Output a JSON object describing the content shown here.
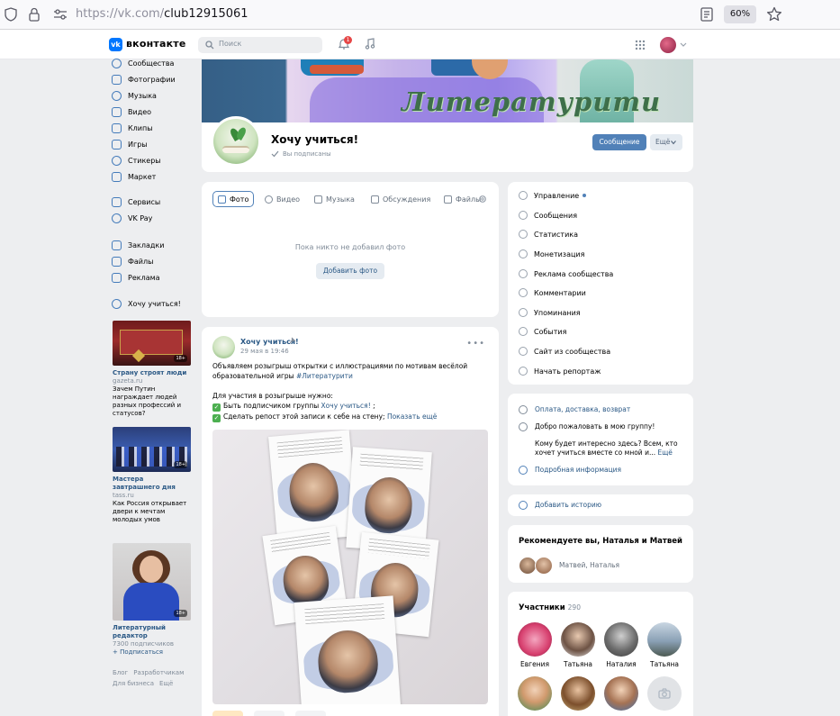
{
  "browser": {
    "url_host": "https://vk.com/",
    "url_path": "club12915061",
    "zoom": "60%"
  },
  "header": {
    "brand": "вконтакте",
    "logo_text": "vk",
    "search_placeholder": "Поиск",
    "notifications_count": "1"
  },
  "left_nav": {
    "items": [
      {
        "label": "Сообщества",
        "icon": "community-icon"
      },
      {
        "label": "Фотографии",
        "icon": "photos-icon"
      },
      {
        "label": "Музыка",
        "icon": "music-icon"
      },
      {
        "label": "Видео",
        "icon": "video-icon"
      },
      {
        "label": "Клипы",
        "icon": "clips-icon"
      },
      {
        "label": "Игры",
        "icon": "games-icon"
      },
      {
        "label": "Стикеры",
        "icon": "stickers-icon"
      },
      {
        "label": "Маркет",
        "icon": "market-icon"
      },
      {
        "label": "Сервисы",
        "icon": "services-icon"
      },
      {
        "label": "VK Pay",
        "icon": "vkpay-icon"
      },
      {
        "label": "Закладки",
        "icon": "bookmarks-icon"
      },
      {
        "label": "Файлы",
        "icon": "files-icon"
      },
      {
        "label": "Реклама",
        "icon": "ads-icon"
      },
      {
        "label": "Хочу учиться!",
        "icon": "group-icon"
      }
    ]
  },
  "ads": [
    {
      "title": "Страну строят люди",
      "domain": "gazeta.ru",
      "text": "Зачем Путин награждает людей разных профессий и статусов?",
      "age": "18+"
    },
    {
      "title": "Мастера завтрашнего дня",
      "domain": "tass.ru",
      "text": "Как Россия открывает двери к мечтам молодых умов",
      "age": "18+"
    },
    {
      "title": "Литературный редактор",
      "domain": "7300 подписчиков",
      "text": "+ Подписаться",
      "age": "18+"
    }
  ],
  "footer": {
    "links": [
      "Блог",
      "Разработчикам",
      "Для бизнеса",
      "Ещё"
    ]
  },
  "cover": {
    "title_art": "Литературити"
  },
  "group": {
    "name": "Хочу учиться!",
    "status": "Вы подписаны",
    "message_button": "Сообщение",
    "more_button": "Ещё"
  },
  "media": {
    "tabs": [
      "Фото",
      "Видео",
      "Музыка",
      "Обсуждения",
      "Файлы"
    ],
    "empty_text": "Пока никто не добавил фото",
    "add_photo_button": "Добавить фото"
  },
  "post": {
    "author": "Хочу учиться!",
    "date": "29 мая в 19:46",
    "line1": "Объявляем розыгрыш открытки с иллюстрациями по мотивам весёлой",
    "line2": "образовательной игры ",
    "hashtag": "#Литературити",
    "line3": "Для участия в розыгрыше нужно:",
    "req1_prefix": "Быть подписчиком группы ",
    "req1_link": "Хочу учиться!",
    "req1_suffix": " ;",
    "req2_prefix": "Сделать репост этой записи к себе на стену; ",
    "show_more": "Показать ещё"
  },
  "manage_menu": {
    "items": [
      {
        "label": "Управление",
        "icon": "settings-icon"
      },
      {
        "label": "Сообщения",
        "icon": "messages-icon"
      },
      {
        "label": "Статистика",
        "icon": "stats-icon"
      },
      {
        "label": "Монетизация",
        "icon": "money-icon"
      },
      {
        "label": "Реклама сообщества",
        "icon": "megaphone-icon"
      },
      {
        "label": "Комментарии",
        "icon": "comments-icon"
      },
      {
        "label": "Упоминания",
        "icon": "mention-icon"
      },
      {
        "label": "События",
        "icon": "events-icon"
      },
      {
        "label": "Сайт из сообщества",
        "icon": "globe-icon"
      },
      {
        "label": "Начать репортаж",
        "icon": "broadcast-icon"
      }
    ]
  },
  "info": {
    "delivery": "Оплата, доставка, возврат",
    "welcome": "Добро пожаловать в мою группу!",
    "question_l1": "Кому будет интересно здесь? Всем, кто",
    "question_l2": "хочет учиться вместе со мной и... ",
    "question_more": "Ещё",
    "details": "Подробная информация"
  },
  "story": {
    "label": "Добавить историю"
  },
  "recommend": {
    "title": "Рекомендуете вы, Наталья и Матвей",
    "names": "Матвей, Наталья"
  },
  "members": {
    "title": "Участники",
    "count": "290",
    "people": [
      "Евгения",
      "Татьяна",
      "Наталия",
      "Татьяна"
    ]
  },
  "colors": {
    "accent": "#5181b8",
    "link": "#2a5885",
    "background": "#edeef0"
  }
}
